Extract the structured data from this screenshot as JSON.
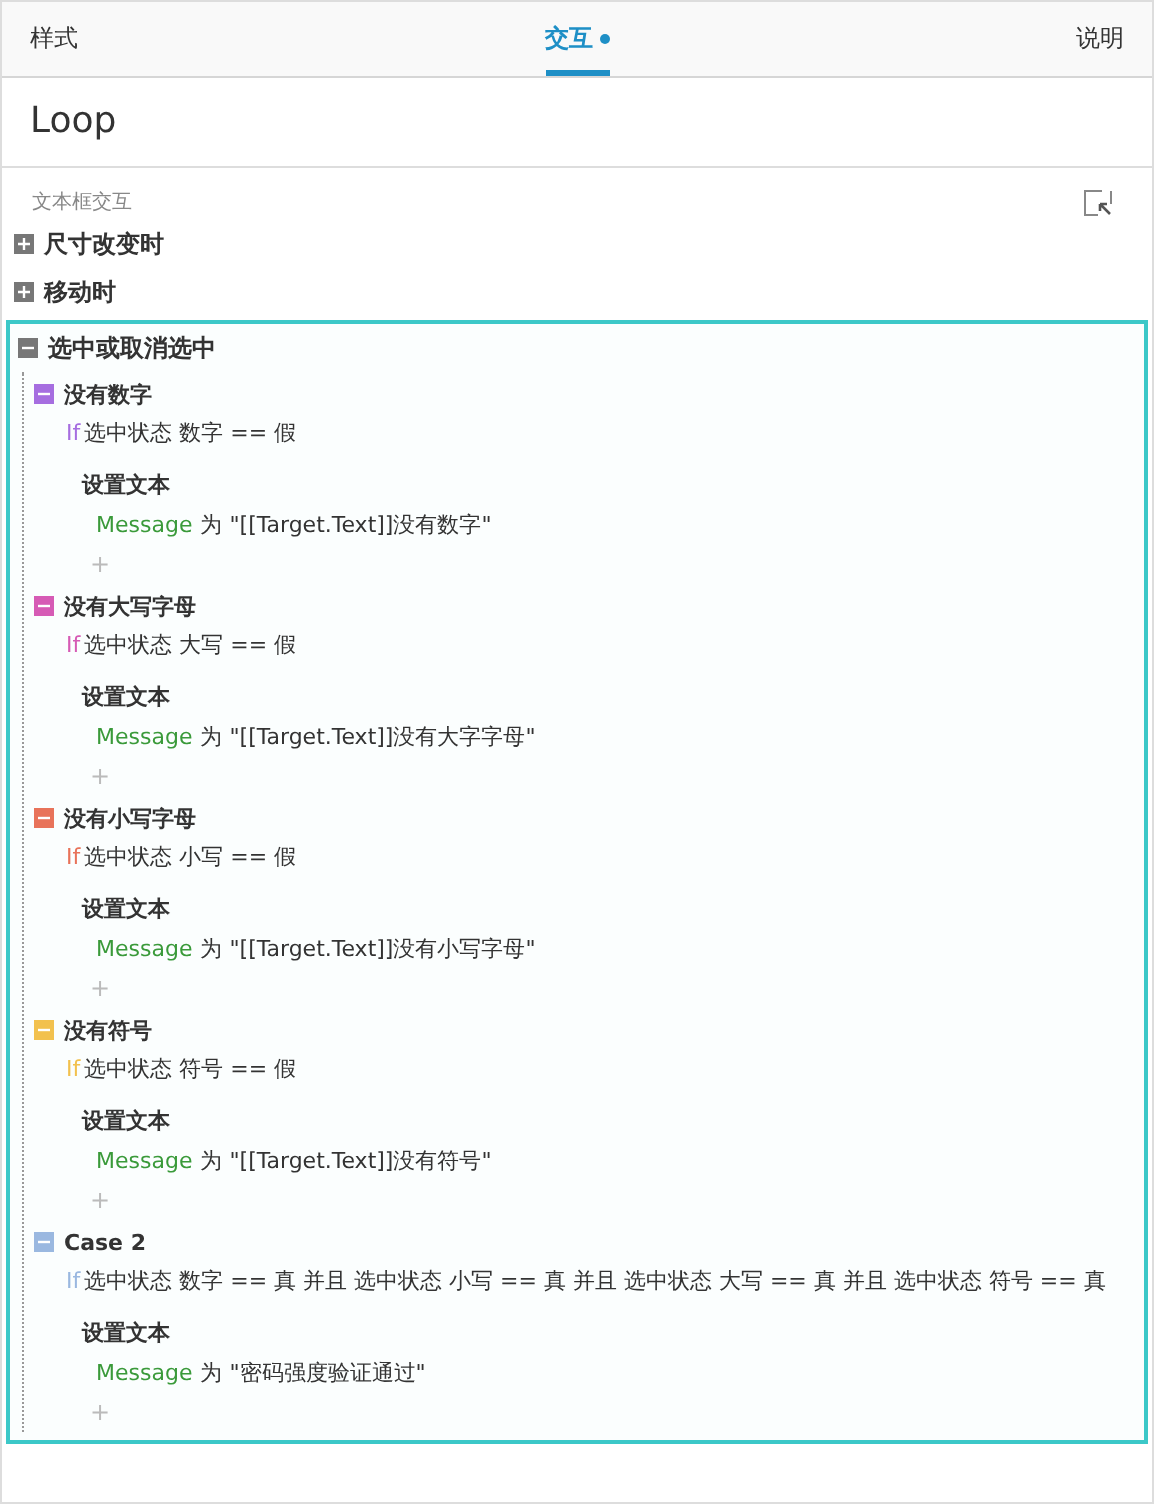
{
  "tabs": [
    {
      "label": "样式",
      "selected": false,
      "dot": false
    },
    {
      "label": "交互",
      "selected": true,
      "dot": true
    },
    {
      "label": "说明",
      "selected": false,
      "dot": false
    }
  ],
  "title": "Loop",
  "section": {
    "label": "文本框交互"
  },
  "events": [
    {
      "label": "尺寸改变时",
      "expanded": false,
      "selected": false
    },
    {
      "label": "移动时",
      "expanded": false,
      "selected": false
    },
    {
      "label": "选中或取消选中",
      "expanded": true,
      "selected": true,
      "cases": [
        {
          "name": "没有数字",
          "color": "#a66ee0",
          "if_keyword": "If",
          "condition": "选中状态 数字 == 假",
          "actions": [
            {
              "title": "设置文本",
              "target": "Message",
              "detail": "为 \"[[Target.Text]]没有数字\""
            }
          ],
          "add": "+"
        },
        {
          "name": "没有大写字母",
          "color": "#d65bb5",
          "if_keyword": "If",
          "condition": "选中状态 大写 == 假",
          "actions": [
            {
              "title": "设置文本",
              "target": "Message",
              "detail": "为 \"[[Target.Text]]没有大字字母\""
            }
          ],
          "add": "+"
        },
        {
          "name": "没有小写字母",
          "color": "#e8735a",
          "if_keyword": "If",
          "condition": "选中状态 小写 == 假",
          "actions": [
            {
              "title": "设置文本",
              "target": "Message",
              "detail": "为 \"[[Target.Text]]没有小写字母\""
            }
          ],
          "add": "+"
        },
        {
          "name": "没有符号",
          "color": "#f2c14e",
          "if_keyword": "If",
          "condition": "选中状态 符号 == 假",
          "actions": [
            {
              "title": "设置文本",
              "target": "Message",
              "detail": "为 \"[[Target.Text]]没有符号\""
            }
          ],
          "add": "+"
        },
        {
          "name": "Case 2",
          "color": "#9ab8e0",
          "if_keyword": "If",
          "condition": "选中状态 数字 == 真 并且 选中状态 小写 == 真 并且 选中状态 大写 == 真 并且 选中状态 符号 == 真",
          "actions": [
            {
              "title": "设置文本",
              "target": "Message",
              "detail": "为 \"密码强度验证通过\""
            }
          ],
          "add": "+"
        }
      ]
    }
  ]
}
